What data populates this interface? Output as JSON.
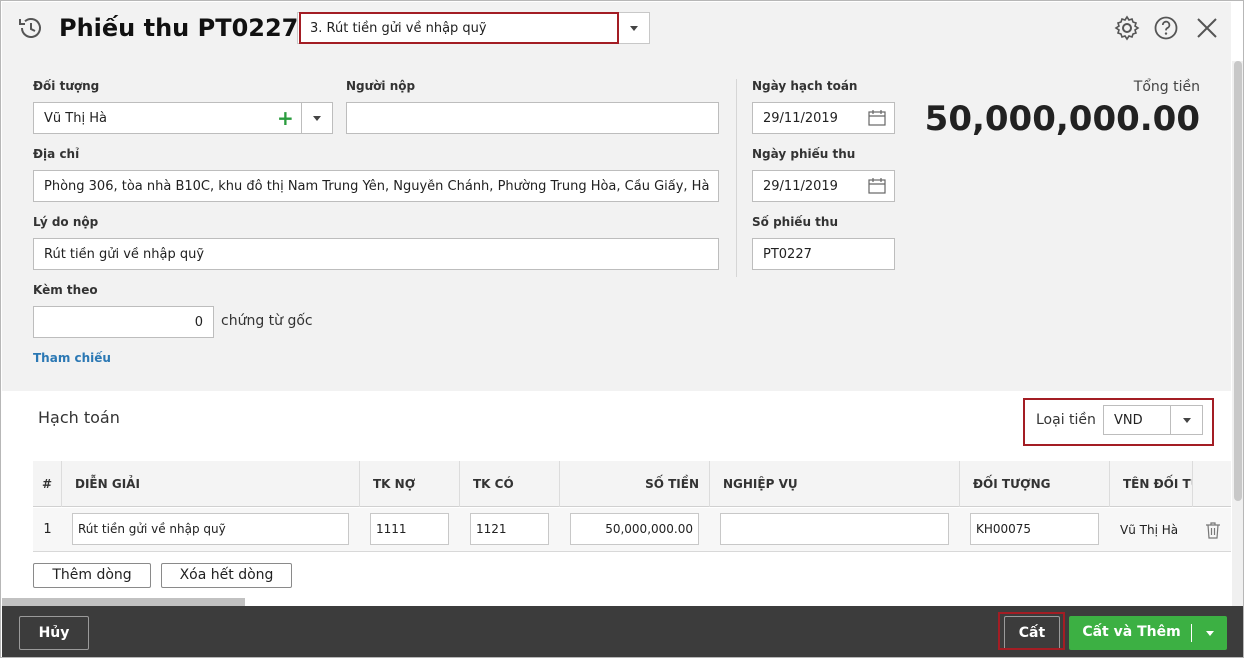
{
  "header": {
    "title": "Phiếu thu PT0227",
    "voucher_type": "3. Rút tiền gửi về nhập quỹ"
  },
  "form": {
    "doi_tuong_label": "Đối tượng",
    "doi_tuong_value": "Vũ Thị Hà",
    "nguoi_nop_label": "Người nộp",
    "nguoi_nop_value": "",
    "dia_chi_label": "Địa chỉ",
    "dia_chi_value": "Phòng 306, tòa nhà B10C, khu đô thị Nam Trung Yên, Nguyễn Chánh, Phường Trung Hòa, Cầu Giấy, Hà",
    "ly_do_label": "Lý do nộp",
    "ly_do_value": "Rút tiền gửi về nhập quỹ",
    "kem_theo_label": "Kèm theo",
    "kem_theo_value": "0",
    "chung_tu_goc": "chứng từ gốc",
    "tham_chieu": "Tham chiếu",
    "ngay_hach_toan_label": "Ngày hạch toán",
    "ngay_hach_toan_value": "29/11/2019",
    "ngay_phieu_thu_label": "Ngày phiếu thu",
    "ngay_phieu_thu_value": "29/11/2019",
    "so_phieu_thu_label": "Số phiếu thu",
    "so_phieu_thu_value": "PT0227"
  },
  "total": {
    "label": "Tổng tiền",
    "value": "50,000,000.00"
  },
  "accounting": {
    "title": "Hạch toán",
    "currency_label": "Loại tiền",
    "currency_value": "VND",
    "columns": [
      "#",
      "DIỄN GIẢI",
      "TK NỢ",
      "TK CÓ",
      "SỐ TIỀN",
      "NGHIỆP VỤ",
      "ĐỐI TƯỢNG",
      "TÊN ĐỐI TƯ"
    ],
    "rows": [
      {
        "no": "1",
        "dien_giai": "Rút tiền gửi về nhập quỹ",
        "tk_no": "1111",
        "tk_co": "1121",
        "so_tien": "50,000,000.00",
        "nghiep_vu": "",
        "doi_tuong": "KH00075",
        "ten_doi_tuong": "Vũ Thị Hà"
      }
    ],
    "add_row": "Thêm dòng",
    "delete_rows": "Xóa hết dòng"
  },
  "footer": {
    "cancel": "Hủy",
    "save": "Cất",
    "save_add": "Cất và Thêm"
  },
  "colors": {
    "highlight": "#a31d24",
    "primary_green": "#3cb043",
    "link": "#2b78b4",
    "footer_bg": "#3c3c3c"
  }
}
